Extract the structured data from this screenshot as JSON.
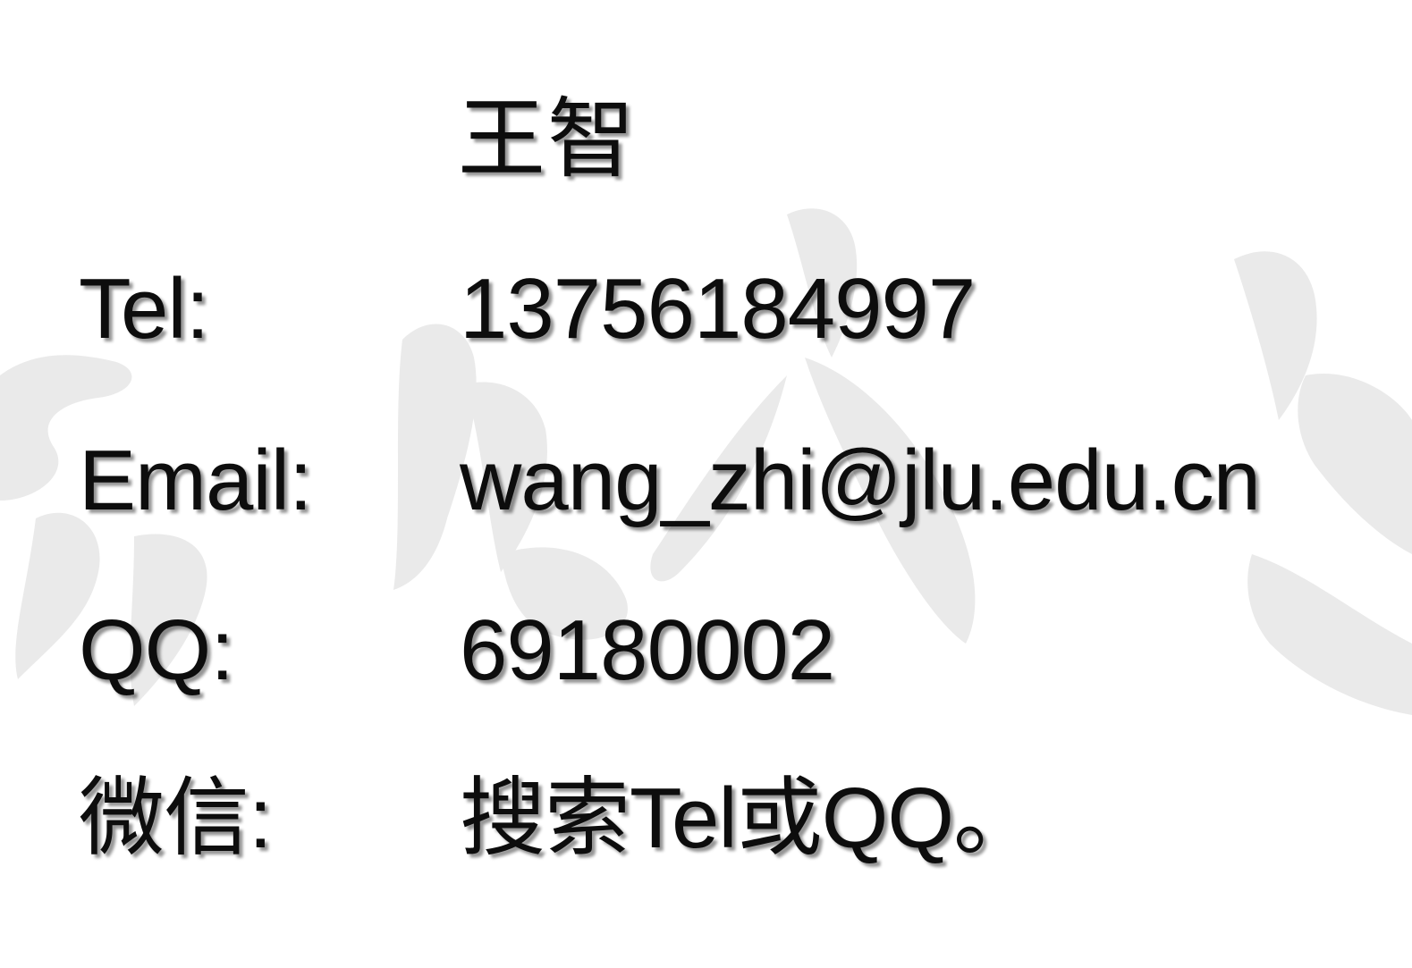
{
  "contact": {
    "name": "王智",
    "rows": [
      {
        "label": "Tel:",
        "value": "13756184997"
      },
      {
        "label": "Email:",
        "value": "wang_zhi@jlu.edu.cn"
      },
      {
        "label": "QQ:",
        "value": "69180002"
      },
      {
        "label": "微信:",
        "value": "搜索Tel或QQ。"
      }
    ]
  },
  "background": {
    "watermark_color": "#e6e6e6",
    "text_color": "#0d0d0d"
  }
}
